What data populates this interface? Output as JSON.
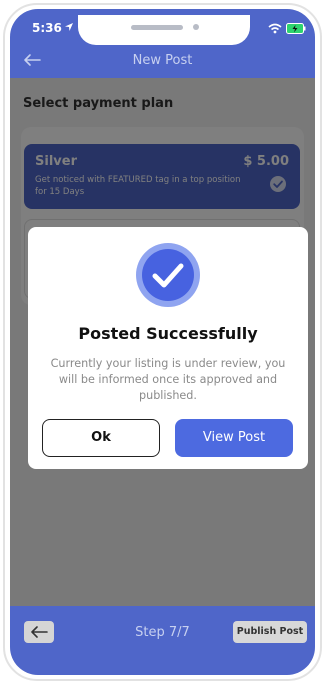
{
  "status_bar": {
    "time": "5:36"
  },
  "header": {
    "title": "New Post"
  },
  "section": {
    "title": "Select payment plan"
  },
  "plans": [
    {
      "name": "Silver",
      "price": "$ 5.00",
      "description": "Get noticed with FEATURED tag in a top position for 15 Days",
      "selected": true
    }
  ],
  "modal": {
    "title": "Posted Successfully",
    "message": "Currently your listing is under review, you will be informed once its approved and published.",
    "ok_label": "Ok",
    "view_label": "View Post"
  },
  "footer": {
    "step": "Step 7/7",
    "publish_label": "Publish Post"
  },
  "colors": {
    "primary": "#4f66c9",
    "button_blue": "#4d6ae0",
    "icon_blue": "#4762e0",
    "icon_ring": "#8fa4f0"
  },
  "icons": [
    "location-arrow-icon",
    "wifi-icon",
    "battery-icon",
    "back-arrow-icon",
    "check-icon",
    "success-check-icon"
  ]
}
